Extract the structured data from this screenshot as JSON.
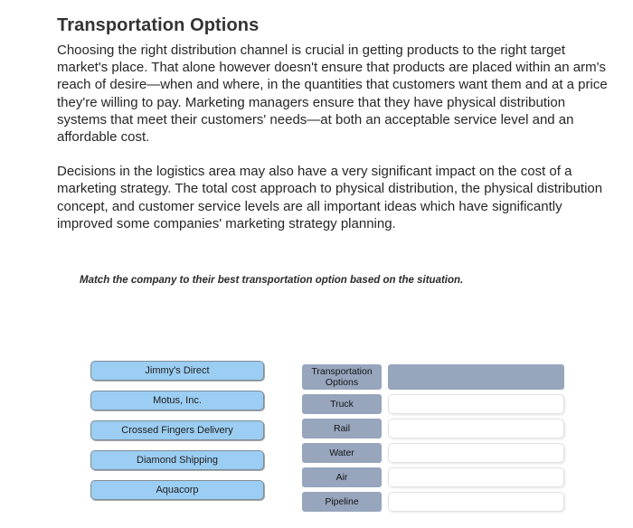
{
  "page": {
    "title": "Transportation Options",
    "paragraphs": [
      "Choosing the right distribution channel is crucial in getting products to the right target market's place. That alone however doesn't ensure that products are placed within an arm's reach of desire—when and where, in the quantities that customers want them and at a price they're willing to pay. Marketing managers ensure that they have physical distribution systems that meet their customers' needs—at both an acceptable service level and an affordable cost.",
      "Decisions in the logistics area may also have a very significant impact on the cost of a marketing strategy. The total cost approach to physical distribution, the physical distribution concept, and customer service levels are all important ideas which have significantly improved some companies' marketing strategy planning."
    ],
    "instruction": "Match the company to their best transportation option based on the situation."
  },
  "companies": [
    {
      "label": "Jimmy's Direct"
    },
    {
      "label": "Motus, Inc."
    },
    {
      "label": "Crossed Fingers Delivery"
    },
    {
      "label": "Diamond Shipping"
    },
    {
      "label": "Aquacorp"
    }
  ],
  "match_table": {
    "header": {
      "option_label": "Transportation Options",
      "answer_label": ""
    },
    "rows": [
      {
        "option": "Truck",
        "answer": ""
      },
      {
        "option": "Rail",
        "answer": ""
      },
      {
        "option": "Water",
        "answer": ""
      },
      {
        "option": "Air",
        "answer": ""
      },
      {
        "option": "Pipeline",
        "answer": ""
      }
    ]
  },
  "colors": {
    "chip_fill": "#9ccdf2",
    "chip_border": "#7f8c96",
    "table_header_fill": "#97a5bd",
    "drop_border": "#e2e2e4",
    "text": "#262626"
  }
}
